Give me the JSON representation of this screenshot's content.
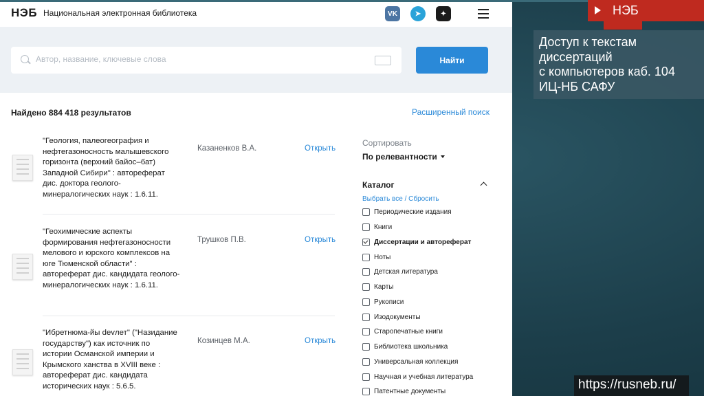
{
  "site": {
    "logo": "НЭБ",
    "library_name": "Национальная электронная библиотека",
    "social": {
      "vk": "VK",
      "telegram": "➤",
      "zen": "✦"
    }
  },
  "search": {
    "placeholder": "Автор, название, ключевые слова",
    "value": "",
    "button_label": "Найти"
  },
  "results": {
    "count_text": "Найдено 884 418 результатов",
    "advanced_search_label": "Расширенный поиск",
    "items": [
      {
        "title": "\"Геология, палеогеография и нефтегазоносность малышевского горизонта (верхний байос–бат) Западной Сибири\" : автореферат дис. доктора геолого-минералогических наук : 1.6.11.",
        "author": "Казаненков В.А.",
        "open_label": "Открыть"
      },
      {
        "title": "\"Геохимические аспекты формирования нефтегазоносности мелового и юрского комплексов на юге Тюменской области\" : автореферат дис. кандидата геолого-минералогических наук : 1.6.11.",
        "author": "Трушков П.В.",
        "open_label": "Открыть"
      },
      {
        "title": "\"Ибретнюма-йы devлет\" (\"Назидание государству\") как источник по истории Османской империи и Крымского ханства в XVIII веке : автореферат дис. кандидата исторических наук : 5.6.5.",
        "author": "Козинцев М.А.",
        "open_label": "Открыть"
      }
    ]
  },
  "sidebar": {
    "sort_label": "Сортировать",
    "sort_value": "По релевантности",
    "catalog_title": "Каталог",
    "select_all": "Выбрать все",
    "link_sep": "/",
    "reset": "Сбросить",
    "catalog_items": [
      {
        "label": "Периодические издания",
        "checked": false
      },
      {
        "label": "Книги",
        "checked": false
      },
      {
        "label": "Диссертации и автореферат",
        "checked": true
      },
      {
        "label": "Ноты",
        "checked": false
      },
      {
        "label": "Детская литература",
        "checked": false
      },
      {
        "label": "Карты",
        "checked": false
      },
      {
        "label": "Рукописи",
        "checked": false
      },
      {
        "label": "Изодокументы",
        "checked": false
      },
      {
        "label": "Старопечатные книги",
        "checked": false
      },
      {
        "label": "Библиотека школьника",
        "checked": false
      },
      {
        "label": "Универсальная коллекция",
        "checked": false
      },
      {
        "label": "Научная и учебная литература",
        "checked": false
      },
      {
        "label": "Патентные документы",
        "checked": false
      }
    ]
  },
  "slide": {
    "tag": "НЭБ",
    "note": "Доступ к текстам\nдиссертаций\nс компьютеров каб. 104\nИЦ-НБ САФУ",
    "url": "https://rusneb.ru/"
  },
  "colors": {
    "accent": "#2a89d8",
    "tag_red": "#bf2a1f",
    "background": "#1c3e4a"
  }
}
